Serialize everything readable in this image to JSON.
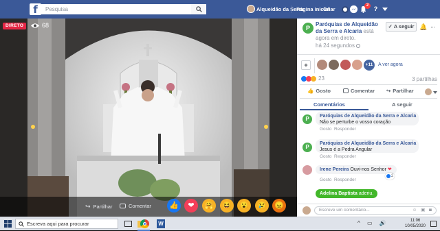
{
  "topbar": {
    "search_placeholder": "Pesquisa",
    "profile_name": "Alqueidão da Serra",
    "home_label": "Página inicial",
    "create_label": "Criar",
    "notification_count": "2"
  },
  "video": {
    "live_label": "DIRETO",
    "viewer_count": "68",
    "share_label": "Partilhar",
    "comment_label": "Comentar",
    "reactions": [
      {
        "name": "like-reaction",
        "glyph": "👍",
        "color": "#1877f2"
      },
      {
        "name": "love-reaction",
        "glyph": "❤",
        "color": "#f33e58"
      },
      {
        "name": "care-reaction",
        "glyph": "🤗",
        "color": "#f7b125"
      },
      {
        "name": "haha-reaction",
        "glyph": "😆",
        "color": "#f7b125"
      },
      {
        "name": "wow-reaction",
        "glyph": "😮",
        "color": "#f7b125"
      },
      {
        "name": "sad-reaction",
        "glyph": "😢",
        "color": "#f7b125"
      },
      {
        "name": "angry-reaction",
        "glyph": "😠",
        "color": "#e9710f"
      }
    ]
  },
  "post": {
    "page_name": "Paróquias de Alqueidão da Serra e Alcaria",
    "live_text": "está agora em direto.",
    "time": "há 24 segundos",
    "follow_label": "A seguir",
    "viewers_extra": "+11",
    "watching_now": "A ver agora",
    "reaction_count": "23",
    "shares_count": "3 partilhas",
    "action_like": "Gosto",
    "action_comment": "Comentar",
    "action_share": "Partilhar",
    "tab_comments": "Comentários",
    "tab_following": "A seguir"
  },
  "comments": [
    {
      "author": "Paróquias de Alqueidão da Serra e Alcaria",
      "text": "Não se perturbe o vosso coração",
      "like": "Gosto",
      "reply": "Responder"
    },
    {
      "author": "Paróquias de Alqueidão da Serra e Alcaria",
      "text": "Jesus é a Pedra Angular",
      "like": "Gosto",
      "reply": "Responder"
    },
    {
      "author": "Irene Pereira",
      "text": "Ouvi-nos Senhor",
      "like": "Gosto",
      "reply": "Responder",
      "reactions": "2"
    }
  ],
  "join_notice": {
    "name": "Adelina Baptista",
    "text": "aderiu."
  },
  "composer": {
    "placeholder": "Escreve um comentário..."
  },
  "taskbar": {
    "search_placeholder": "Escreva aqui para procurar",
    "time": "11:06",
    "date": "10/05/2020"
  },
  "colors": {
    "facebook_blue": "#3b5998",
    "live_red": "#e42645",
    "link_blue": "#385898",
    "join_green": "#42b72a"
  }
}
